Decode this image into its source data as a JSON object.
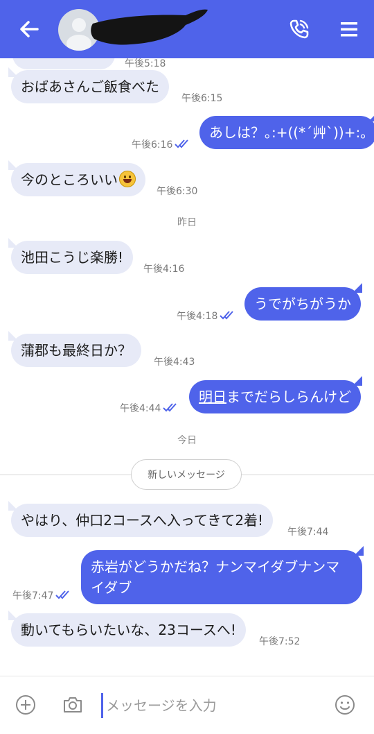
{
  "header": {
    "icons": [
      "back-arrow-icon",
      "avatar",
      "phone-icon",
      "menu-icon"
    ],
    "accent_color": "#4f63ea"
  },
  "messages": [
    {
      "id": "m0",
      "dir": "in",
      "text": "",
      "time": "午後5:18"
    },
    {
      "id": "m1",
      "dir": "in",
      "text": "おばあさんご飯食べた",
      "time": "午後6:15"
    },
    {
      "id": "m2",
      "dir": "out",
      "text": "あしは？｡:+((*´艸`))+:｡",
      "time": "午後6:16",
      "read": true
    },
    {
      "id": "m3",
      "dir": "in",
      "text": "今のところいい",
      "emoji": "smiley-emoji",
      "time": "午後6:30"
    },
    {
      "id": "m4",
      "dir": "in",
      "text": "池田こうじ楽勝!",
      "time": "午後4:16"
    },
    {
      "id": "m5",
      "dir": "out",
      "text": "うでがちがうか",
      "time": "午後4:18",
      "read": true
    },
    {
      "id": "m6",
      "dir": "in",
      "text": "蒲郡も最終日か？",
      "time": "午後4:43"
    },
    {
      "id": "m7",
      "dir": "out",
      "text_underlined": "明日",
      "text": "までだらしらんけど",
      "time": "午後4:44",
      "read": true
    },
    {
      "id": "m8",
      "dir": "in",
      "text": "やはり、仲口2コースへ入ってきて2着!",
      "time": "午後7:44"
    },
    {
      "id": "m9",
      "dir": "out",
      "text_line1": "赤岩がどうかだね？ナンマイダブナンマ",
      "text_line2": "イダブ",
      "time": "午後7:47",
      "read": true
    },
    {
      "id": "m10",
      "dir": "in",
      "text": "動いてもらいたいな、23コースへ!",
      "time": "午後7:52"
    }
  ],
  "separators": {
    "yesterday": "昨日",
    "today": "今日",
    "new_messages": "新しいメッセージ"
  },
  "input": {
    "placeholder": "メッセージを入力",
    "icons": [
      "add-icon",
      "camera-icon",
      "emoji-icon"
    ]
  }
}
